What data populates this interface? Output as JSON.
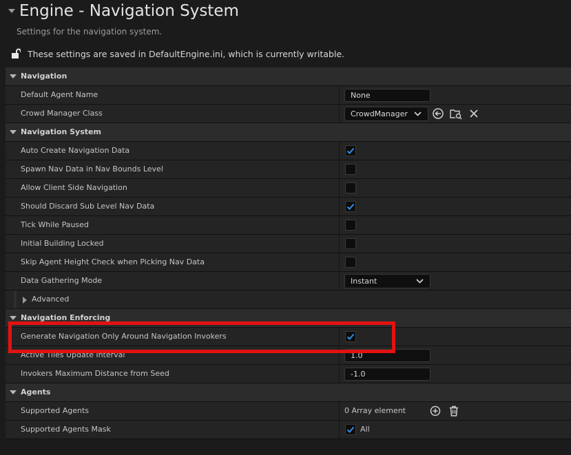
{
  "header": {
    "title": "Engine - Navigation System",
    "subtitle": "Settings for the navigation system.",
    "config_notice": "These settings are saved in DefaultEngine.ini, which is currently writable."
  },
  "sections": {
    "navigation": {
      "label": "Navigation",
      "default_agent_name": {
        "label": "Default Agent Name",
        "value": "None"
      },
      "crowd_manager_class": {
        "label": "Crowd Manager Class",
        "value": "CrowdManager"
      }
    },
    "navigation_system": {
      "label": "Navigation System",
      "auto_create": {
        "label": "Auto Create Navigation Data",
        "checked": true
      },
      "spawn_nav_data": {
        "label": "Spawn Nav Data in Nav Bounds Level",
        "checked": false
      },
      "allow_client": {
        "label": "Allow Client Side Navigation",
        "checked": false
      },
      "discard_sub_level": {
        "label": "Should Discard Sub Level Nav Data",
        "checked": true
      },
      "tick_paused": {
        "label": "Tick While Paused",
        "checked": false
      },
      "initial_locked": {
        "label": "Initial Building Locked",
        "checked": false
      },
      "skip_height": {
        "label": "Skip Agent Height Check when Picking Nav Data",
        "checked": false
      },
      "data_gathering": {
        "label": "Data Gathering Mode",
        "value": "Instant"
      },
      "advanced": {
        "label": "Advanced"
      }
    },
    "navigation_enforcing": {
      "label": "Navigation Enforcing",
      "generate_around_invokers": {
        "label": "Generate Navigation Only Around Navigation Invokers",
        "checked": true
      },
      "active_tiles": {
        "label": "Active Tiles Update Interval",
        "value": "1.0"
      },
      "invokers_max_distance": {
        "label": "Invokers Maximum Distance from Seed",
        "value": "-1.0"
      }
    },
    "agents": {
      "label": "Agents",
      "supported_agents": {
        "label": "Supported Agents",
        "value": "0 Array element"
      },
      "supported_agents_mask": {
        "label": "Supported Agents Mask",
        "value": "All",
        "checked": true
      }
    }
  },
  "colors": {
    "checkmark": "#2f8fe8",
    "highlight": "#e31212",
    "background": "#1b1b1b"
  },
  "icons": [
    "lock-open-icon",
    "use-selected-icon",
    "browse-icon",
    "clear-icon",
    "add-element-icon",
    "delete-all-icon",
    "chevron-down-icon",
    "checkmark-icon"
  ]
}
